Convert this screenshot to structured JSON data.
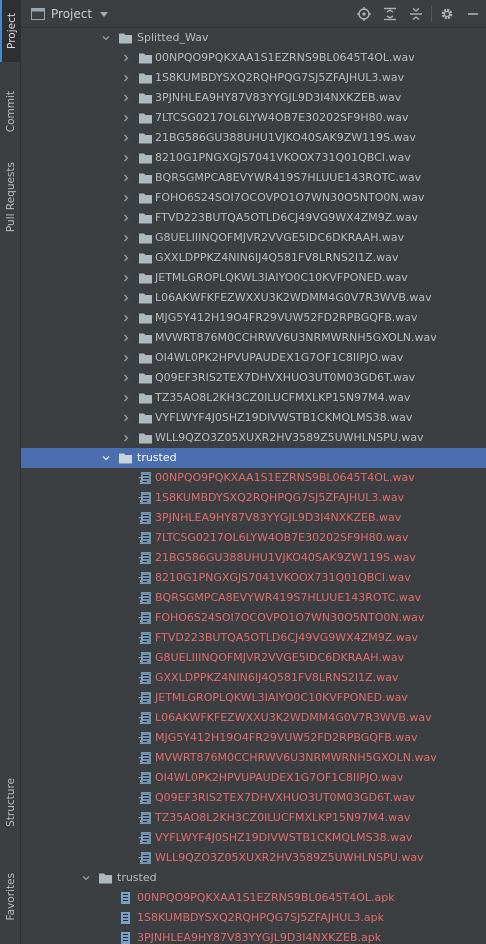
{
  "header": {
    "title": "Project"
  },
  "left_tabs": [
    "Project",
    "Commit",
    "Pull Requests"
  ],
  "bottom_tabs": [
    "Structure",
    "Favorites"
  ],
  "folders": {
    "splitted": "Splitted_Wav",
    "trusted_wav": "trusted",
    "trusted_apk": "trusted"
  },
  "wav_files": [
    "00NPQO9PQKXAA1S1EZRNS9BL0645T4OL.wav",
    "1S8KUMBDYSXQ2RQHPQG7SJ5ZFAJHUL3.wav",
    "3PJNHLEA9HY87V83YYGJL9D3I4NXKZEB.wav",
    "7LTCSG0217OL6LYW4OB7E30202SF9H80.wav",
    "21BG586GU388UHU1VJKO40SAK9ZW119S.wav",
    "8210G1PNGXGJS7041VKOOX731Q01QBCI.wav",
    "BQRSGMPCA8EVYWR419S7HLUUE143ROTC.wav",
    "FOHO6S24SOI7OCOVPO1O7WN30O5NTO0N.wav",
    "FTVD223BUTQA5OTLD6CJ49VG9WX4ZM9Z.wav",
    "G8UELIIINQOFMJVR2VVGE5IDC6DKRAAH.wav",
    "GXXLDPPKZ4NIN6IJ4Q581FV8LRNS2I1Z.wav",
    "JETMLGROPLQKWL3IAIYO0C10KVFPONED.wav",
    "L06AKWFKFEZWXXU3K2WDMM4G0V7R3WVB.wav",
    "MJG5Y412H19O4FR29VUW52FD2RPBGQFB.wav",
    "MVWRT876M0CCHRWV6U3NRMWRNH5GXOLN.wav",
    "OI4WL0PK2HPVUPAUDEX1G7OF1C8IIPJO.wav",
    "Q09EF3RIS2TEX7DHVXHUO3UT0M03GD6T.wav",
    "TZ35AO8L2KH3CZ0ILUCFMXLKP15N97M4.wav",
    "VYFLWYF4J0SHZ19DIVWSTB1CKMQLMS38.wav",
    "WLL9QZO3Z05XUXR2HV3589Z5UWHLNSPU.wav"
  ],
  "apk_files": [
    "00NPQO9PQKXAA1S1EZRNS9BL0645T4OL.apk",
    "1S8KUMBDYSXQ2RQHPQG7SJ5ZFAJHUL3.apk",
    "3PJNHLEA9HY87V83YYGJL9D3I4NXKZEB.apk"
  ],
  "colors": {
    "selection": "#4b6eaf",
    "unversioned_red": "#e06c6c",
    "folder": "#aeb9c0",
    "accent": "#4a88c7"
  }
}
